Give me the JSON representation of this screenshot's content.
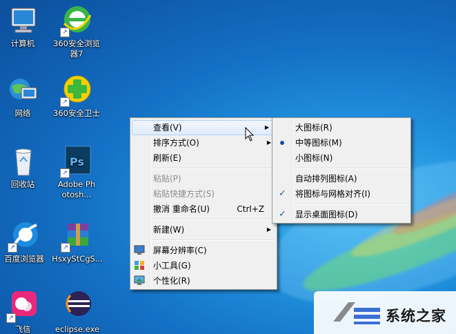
{
  "desktop_icons": [
    {
      "label": "计算机",
      "icon": "computer-icon"
    },
    {
      "label": "360安全浏览器7",
      "icon": "browser-360-icon"
    },
    {
      "label": "网络",
      "icon": "network-icon"
    },
    {
      "label": "360安全卫士",
      "icon": "security-360-icon"
    },
    {
      "label": "回收站",
      "icon": "recycle-bin-icon"
    },
    {
      "label": "Adobe Photosh...",
      "icon": "photoshop-icon"
    },
    {
      "label": "百度浏览器",
      "icon": "baidu-browser-icon"
    },
    {
      "label": "HsxyStCgS...",
      "icon": "winrar-archive-icon"
    },
    {
      "label": "飞信",
      "icon": "fetion-icon"
    },
    {
      "label": "eclipse.exe",
      "icon": "eclipse-icon"
    }
  ],
  "context_menu": {
    "view": "查看(V)",
    "sort_by": "排序方式(O)",
    "refresh": "刷新(E)",
    "paste": "粘贴(P)",
    "paste_shortcut": "粘贴快捷方式(S)",
    "undo_rename": "撤消 重命名(U)",
    "undo_shortcut": "Ctrl+Z",
    "new": "新建(W)",
    "screen_resolution": "屏幕分辨率(C)",
    "gadgets": "小工具(G)",
    "personalize": "个性化(R)"
  },
  "view_submenu": {
    "large_icons": "大图标(R)",
    "medium_icons": "中等图标(M)",
    "small_icons": "小图标(N)",
    "auto_arrange": "自动排列图标(A)",
    "align_to_grid": "将图标与网格对齐(I)",
    "show_desktop_icons": "显示桌面图标(D)"
  },
  "watermark": {
    "text": "系统之家"
  },
  "colors": {
    "menu_bg": "#f0f0f0",
    "highlight": "#e0ecfb",
    "desktop": "#1470c4"
  }
}
